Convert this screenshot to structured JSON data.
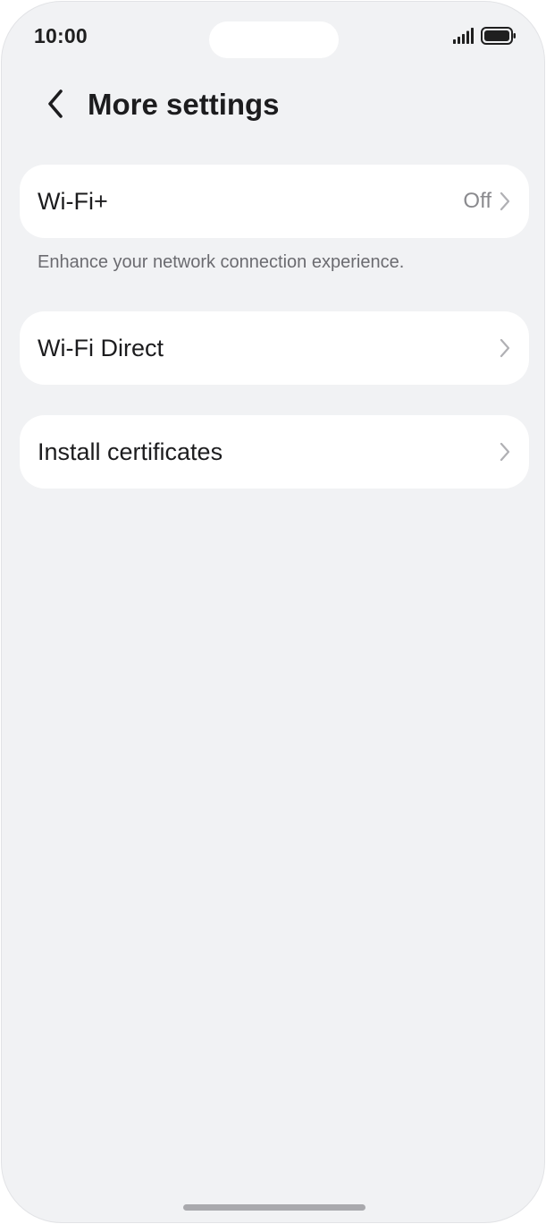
{
  "status_bar": {
    "time": "10:00",
    "icons": [
      "signal-icon",
      "battery-icon"
    ]
  },
  "header": {
    "title": "More settings",
    "back_icon": "chevron-left-icon"
  },
  "settings": {
    "wifi_plus": {
      "label": "Wi-Fi+",
      "value": "Off",
      "description": "Enhance your network connection experience."
    },
    "wifi_direct": {
      "label": "Wi-Fi Direct"
    },
    "install_certificates": {
      "label": "Install certificates"
    }
  },
  "colors": {
    "background": "#f1f2f4",
    "card": "#ffffff",
    "text_primary": "#1c1c1e",
    "text_secondary": "#8a8a8e"
  }
}
